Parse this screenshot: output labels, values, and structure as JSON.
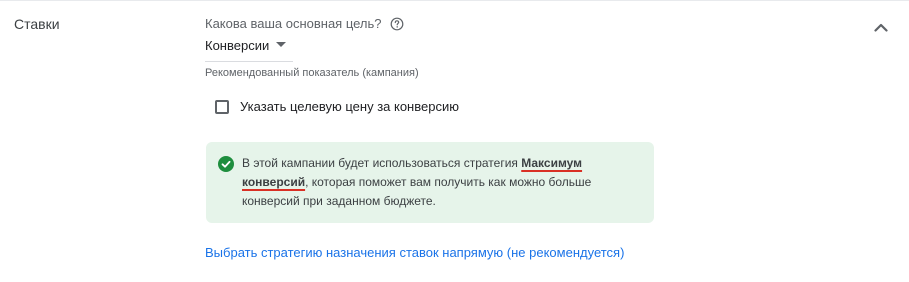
{
  "section": {
    "label": "Ставки"
  },
  "goal": {
    "question": "Какова ваша основная цель?",
    "selected": "Конверсии",
    "hint": "Рекомендованный показатель (кампания)"
  },
  "target_cost": {
    "label": "Указать целевую цену за конверсию",
    "checked": false
  },
  "notice": {
    "text_before": "В этой кампании будет использоваться стратегия ",
    "strategy": "Максимум конверсий",
    "text_after": ", которая поможет вам получить как можно больше конверсий при заданном бюджете."
  },
  "direct_strategy_link": "Выбрать стратегию назначения ставок напрямую (не рекомендуется)",
  "icons": {
    "help": "help-circle-icon",
    "collapse": "chevron-up-icon",
    "success": "check-circle-icon",
    "dropdown": "arrow-drop-down-icon"
  },
  "colors": {
    "link": "#1a73e8",
    "success_bg": "#e6f4ea",
    "success_icon": "#1e8e3e",
    "highlight_underline": "#d93025"
  }
}
